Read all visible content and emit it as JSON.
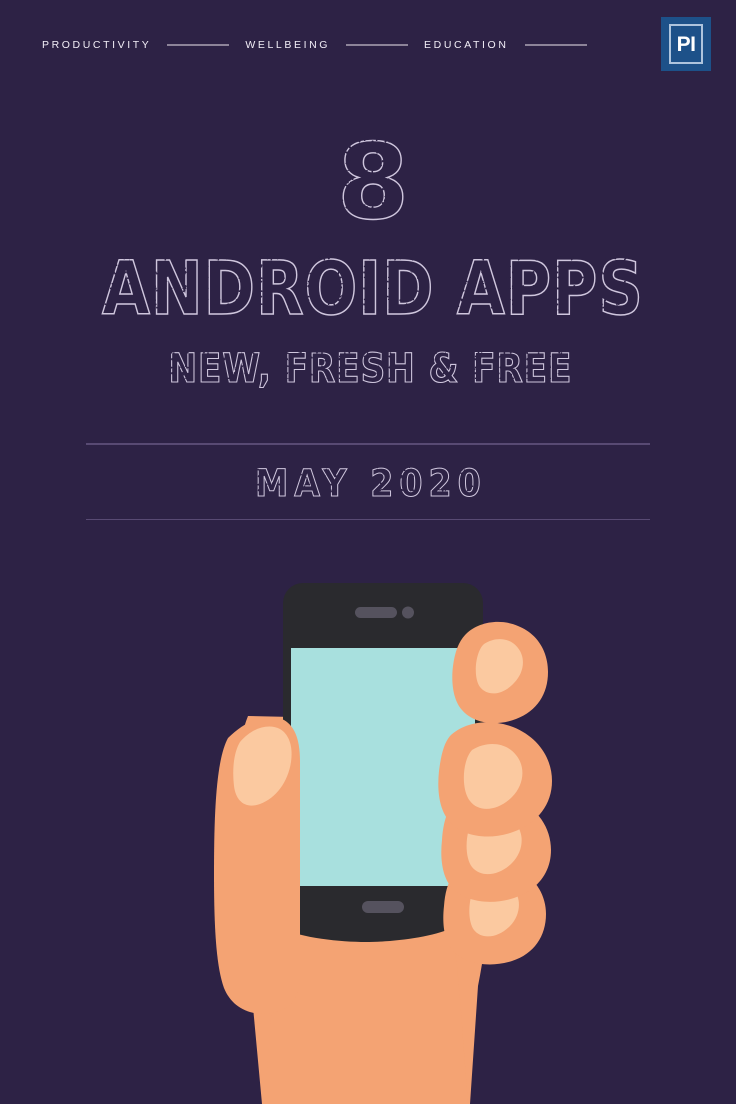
{
  "meta": {
    "background_color": "#2d2245",
    "text_color": "#f7f5fa",
    "accent_blue": "#1d5189",
    "skin_color": "#f4a373",
    "skin_highlight": "#fbc9a0",
    "skin_shadow": "#e8935f",
    "screen_color": "#a8e0de",
    "phone_body_color": "#2a2a2e",
    "phone_detail_color": "#55525e",
    "rule_color": "#584a73",
    "nav_rule_color": "#8d8499"
  },
  "header": {
    "nav_items": [
      {
        "label": "PRODUCTIVITY"
      },
      {
        "label": "WELLBEING"
      },
      {
        "label": "EDUCATION"
      }
    ],
    "logo": {
      "text": "PI",
      "name": "pi-logo"
    }
  },
  "hero": {
    "number": "8",
    "headline": "ANDROID APPS",
    "subheadline": "NEW, FRESH & FREE",
    "date": "MAY 2020"
  },
  "illustration": {
    "name": "hand-holding-smartphone",
    "description": "Flat illustration of a hand holding a smartphone with a blank mint screen",
    "parts": {
      "phone": "smartphone-body",
      "screen": "smartphone-screen",
      "speaker": "earpiece-speaker",
      "camera": "front-camera",
      "home_button": "home-button",
      "thumb": "thumb",
      "fingers": "fingers",
      "palm": "palm"
    }
  }
}
